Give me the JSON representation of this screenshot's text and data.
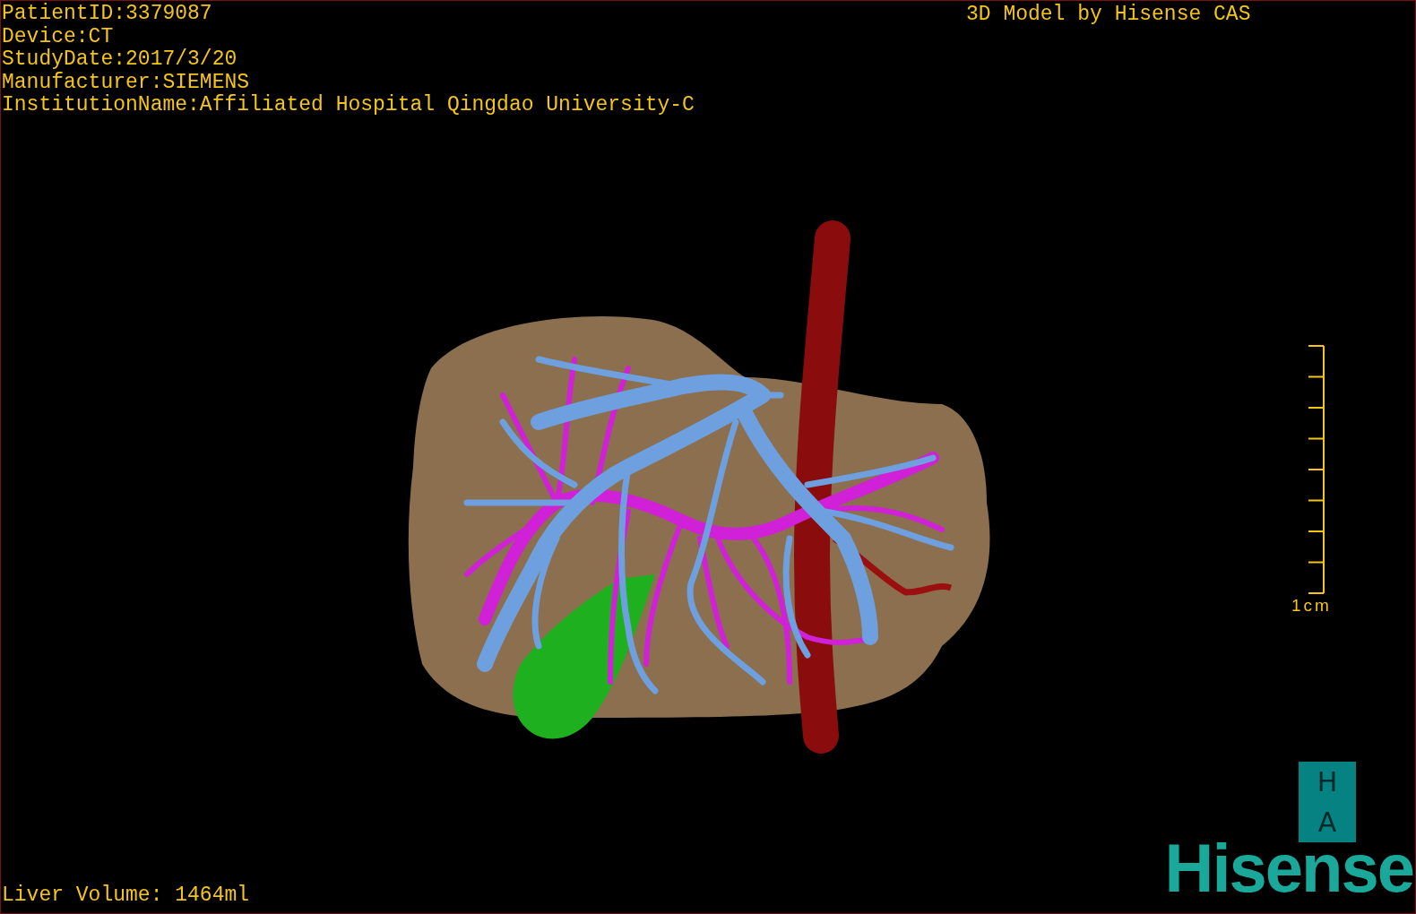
{
  "info_lines": [
    "PatientID:3379087",
    "Device:CT",
    "StudyDate:2017/3/20",
    "Manufacturer:SIEMENS",
    "InstitutionName:Affiliated Hospital Qingdao University-C"
  ],
  "title": "3D Model by Hisense CAS",
  "scale_bar": {
    "label": "1cm"
  },
  "liver_volume": "Liver Volume: 1464ml",
  "badge": {
    "top": "H",
    "bottom": "A"
  },
  "logo": "Hisense"
}
